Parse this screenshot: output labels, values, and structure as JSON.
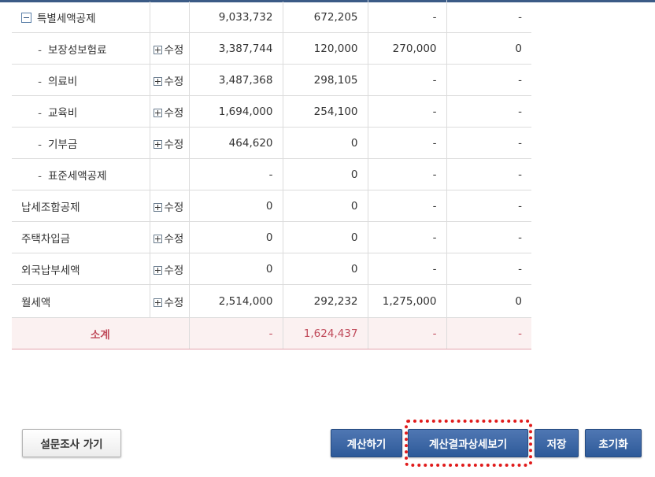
{
  "table": {
    "rows": [
      {
        "kind": "parent",
        "name": "특별세액공제",
        "edit": "",
        "v1": "9,033,732",
        "v2": "672,205",
        "v3": "-",
        "v4": "-"
      },
      {
        "kind": "sub",
        "dash": "-",
        "name": "보장성보험료",
        "edit": "수정",
        "v1": "3,387,744",
        "v2": "120,000",
        "v3": "270,000",
        "v4": "0"
      },
      {
        "kind": "sub",
        "dash": "-",
        "name": "의료비",
        "edit": "수정",
        "v1": "3,487,368",
        "v2": "298,105",
        "v3": "-",
        "v4": "-"
      },
      {
        "kind": "sub",
        "dash": "-",
        "name": "교육비",
        "edit": "수정",
        "v1": "1,694,000",
        "v2": "254,100",
        "v3": "-",
        "v4": "-"
      },
      {
        "kind": "sub",
        "dash": "-",
        "name": "기부금",
        "edit": "수정",
        "v1": "464,620",
        "v2": "0",
        "v3": "-",
        "v4": "-"
      },
      {
        "kind": "sub",
        "dash": "-",
        "name": "표준세액공제",
        "edit": "",
        "v1": "-",
        "v2": "0",
        "v3": "-",
        "v4": "-"
      },
      {
        "kind": "top",
        "name": "납세조합공제",
        "edit": "수정",
        "v1": "0",
        "v2": "0",
        "v3": "-",
        "v4": "-"
      },
      {
        "kind": "top",
        "name": "주택차입금",
        "edit": "수정",
        "v1": "0",
        "v2": "0",
        "v3": "-",
        "v4": "-"
      },
      {
        "kind": "top",
        "name": "외국납부세액",
        "edit": "수정",
        "v1": "0",
        "v2": "0",
        "v3": "-",
        "v4": "-"
      },
      {
        "kind": "top",
        "name": "월세액",
        "edit": "수정",
        "v1": "2,514,000",
        "v2": "292,232",
        "v3": "1,275,000",
        "v4": "0"
      }
    ],
    "subtotal": {
      "label": "소계",
      "v1": "-",
      "v2": "1,624,437",
      "v3": "-",
      "v4": "-"
    }
  },
  "buttons": {
    "survey": "설문조사 가기",
    "calculate": "계산하기",
    "view_details": "계산결과상세보기",
    "save": "저장",
    "reset": "초기화"
  },
  "colors": {
    "button_blue": "#2e5a99",
    "subtotal_text": "#c04a5a",
    "highlight": "#e01b1b"
  }
}
